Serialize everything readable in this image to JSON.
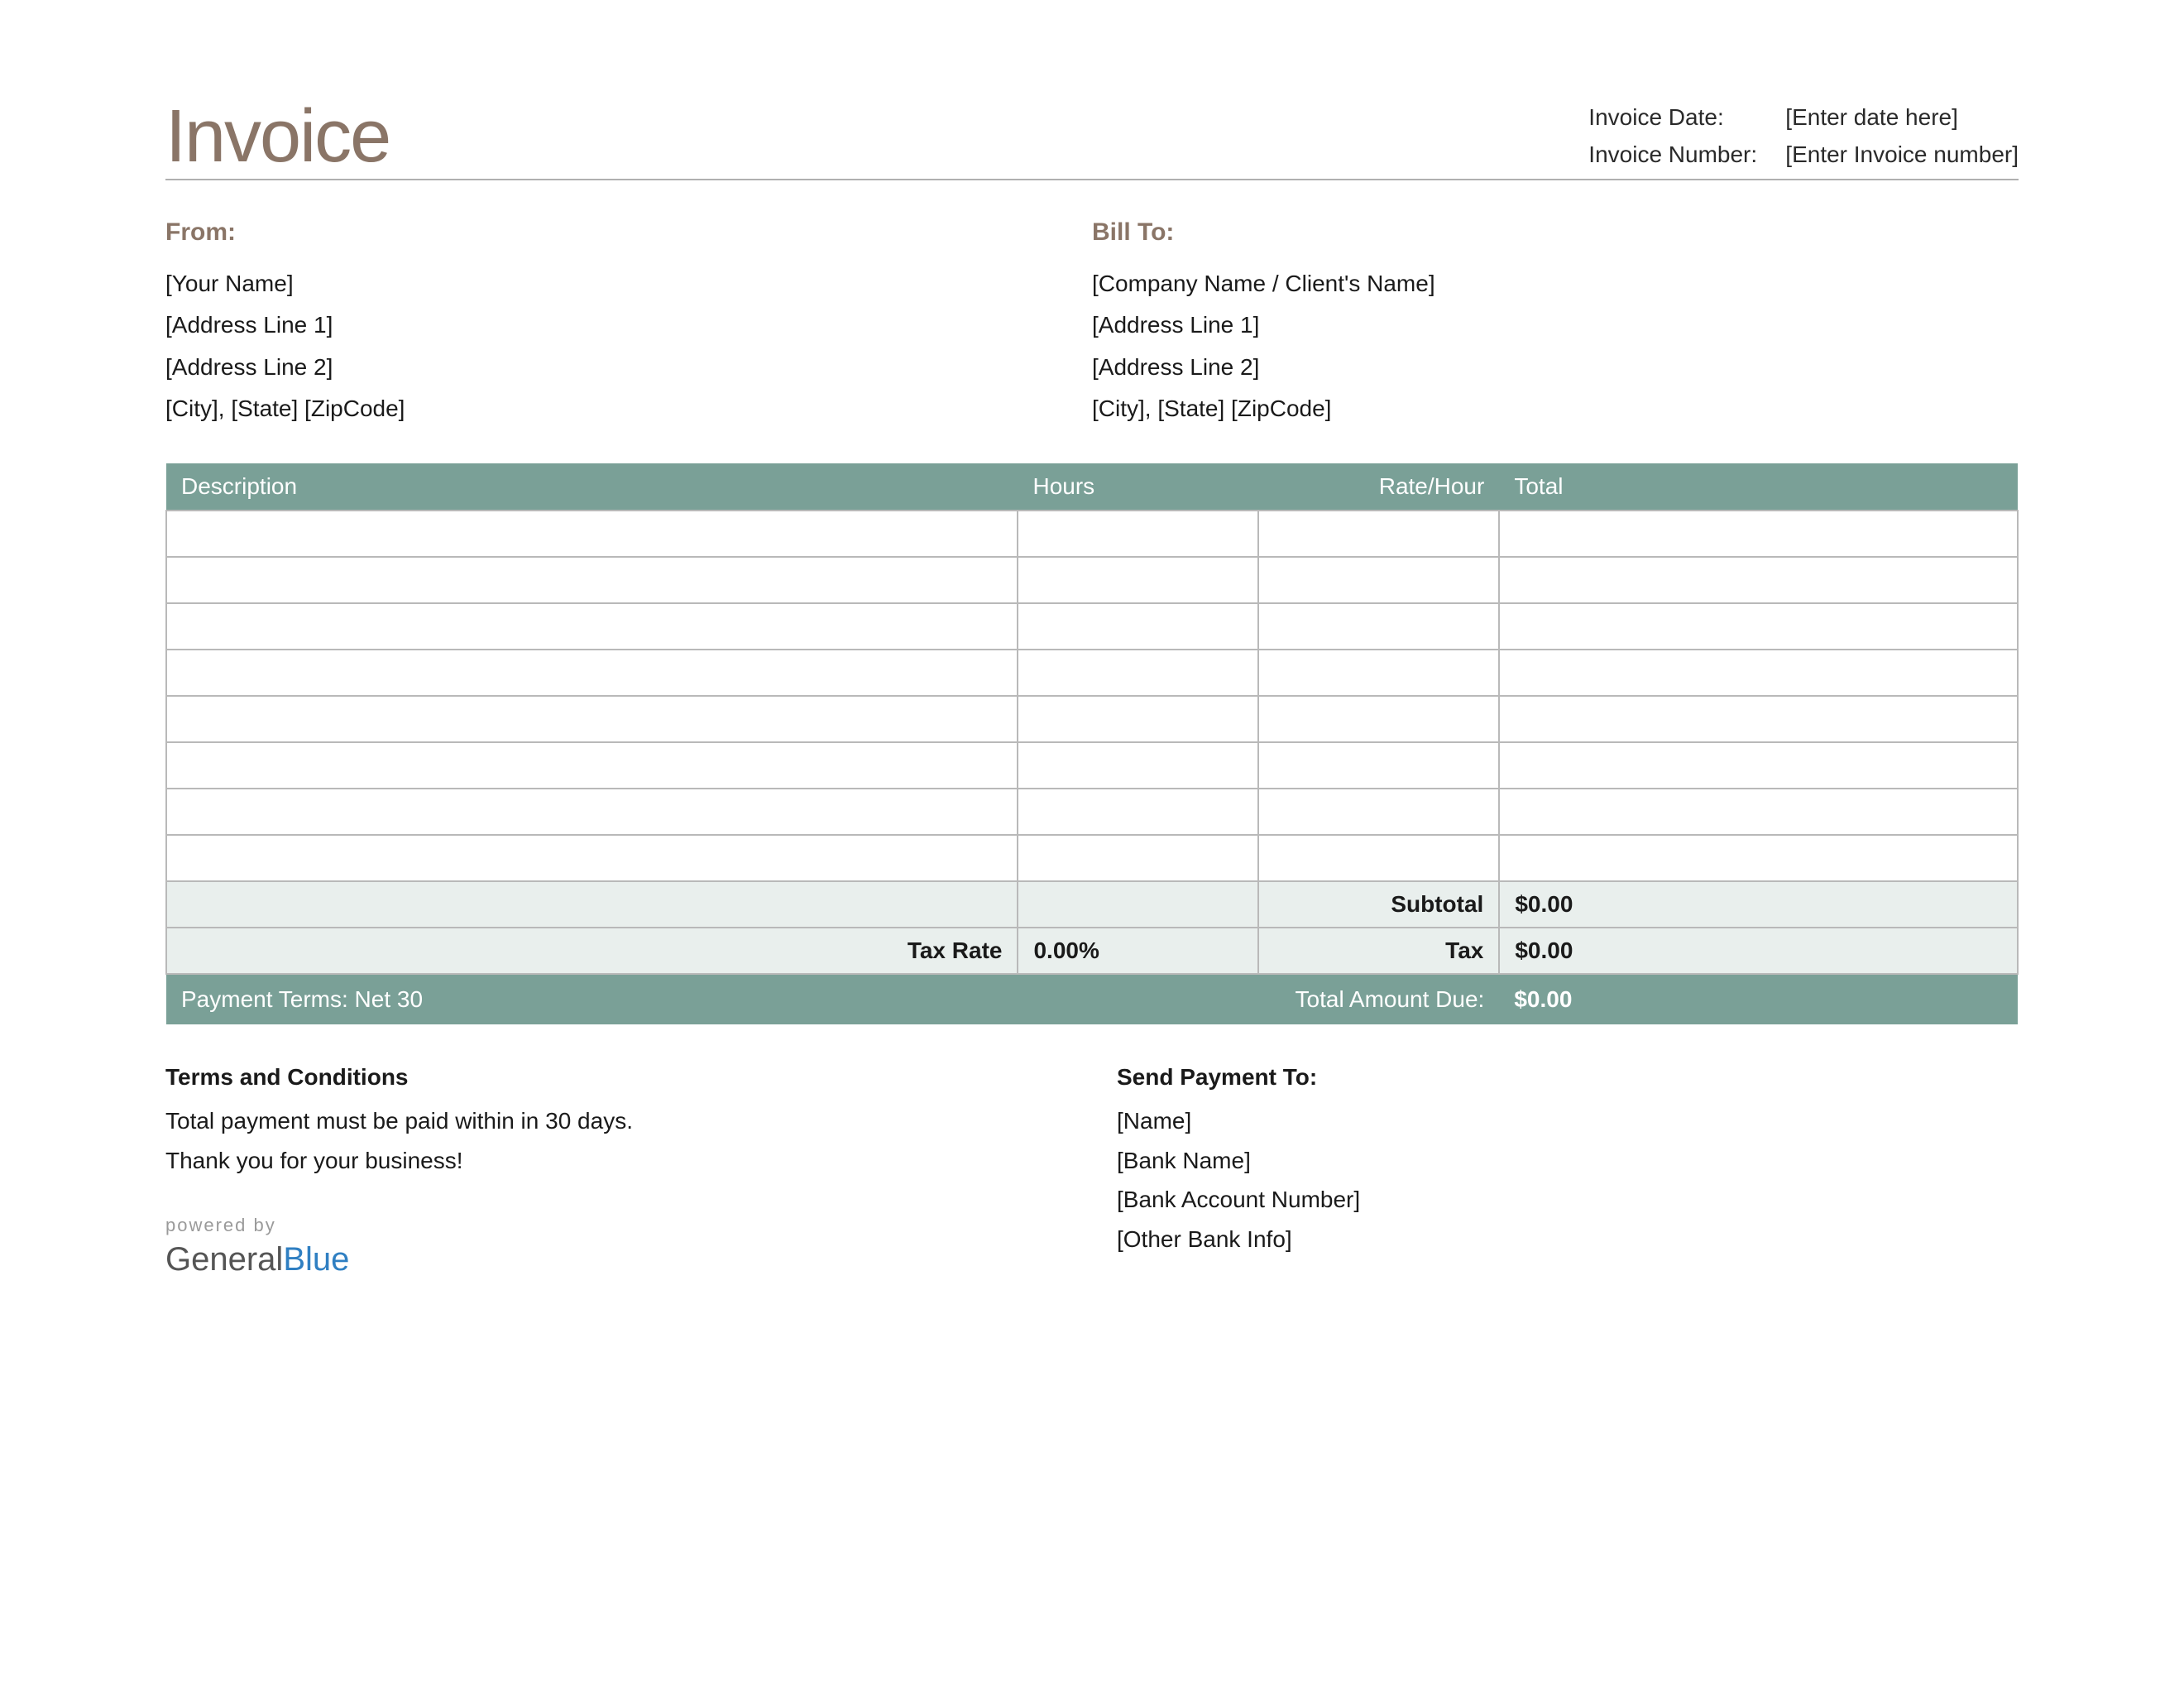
{
  "title": "Invoice",
  "meta": {
    "date_label": "Invoice Date:",
    "date_value": "[Enter date here]",
    "number_label": "Invoice Number:",
    "number_value": "[Enter Invoice number]"
  },
  "from": {
    "heading": "From:",
    "lines": [
      "[Your Name]",
      "[Address Line 1]",
      "[Address Line 2]",
      "[City], [State] [ZipCode]"
    ]
  },
  "bill_to": {
    "heading": "Bill To:",
    "lines": [
      "[Company Name / Client's Name]",
      "[Address Line 1]",
      "[Address Line 2]",
      "[City], [State] [ZipCode]"
    ]
  },
  "columns": {
    "description": "Description",
    "hours": "Hours",
    "rate": "Rate/Hour",
    "total": "Total"
  },
  "rows": [
    {
      "description": "",
      "hours": "",
      "rate": "",
      "total": ""
    },
    {
      "description": "",
      "hours": "",
      "rate": "",
      "total": ""
    },
    {
      "description": "",
      "hours": "",
      "rate": "",
      "total": ""
    },
    {
      "description": "",
      "hours": "",
      "rate": "",
      "total": ""
    },
    {
      "description": "",
      "hours": "",
      "rate": "",
      "total": ""
    },
    {
      "description": "",
      "hours": "",
      "rate": "",
      "total": ""
    },
    {
      "description": "",
      "hours": "",
      "rate": "",
      "total": ""
    },
    {
      "description": "",
      "hours": "",
      "rate": "",
      "total": ""
    }
  ],
  "summary": {
    "subtotal_label": "Subtotal",
    "subtotal_value": "$0.00",
    "tax_rate_label": "Tax Rate",
    "tax_rate_value": "0.00%",
    "tax_label": "Tax",
    "tax_value": "$0.00",
    "payment_terms": "Payment Terms: Net 30",
    "total_due_label": "Total Amount Due:",
    "total_due_value": "$0.00"
  },
  "terms": {
    "heading": "Terms and Conditions",
    "line1": "Total payment must be paid within in 30 days.",
    "line2": "Thank you for your business!"
  },
  "payment_to": {
    "heading": "Send Payment To:",
    "lines": [
      "[Name]",
      "[Bank Name]",
      "[Bank Account Number]",
      "[Other Bank Info]"
    ]
  },
  "brand": {
    "powered_by": "powered by",
    "part1": "General",
    "part2": "Blue"
  }
}
